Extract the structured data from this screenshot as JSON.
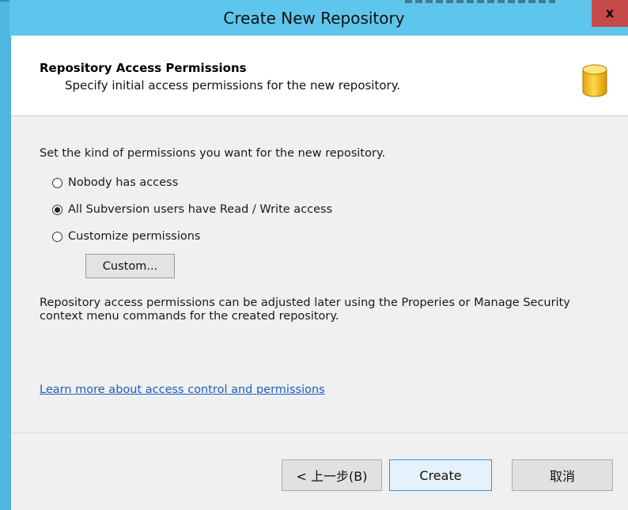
{
  "window": {
    "title": "Create New Repository",
    "close_glyph": "x"
  },
  "header": {
    "title": "Repository Access Permissions",
    "subtitle": "Specify initial access permissions for the new repository.",
    "icon": "database-icon"
  },
  "permissions": {
    "intro": "Set the kind of permissions you want for the new repository.",
    "options": [
      {
        "label": "Nobody has access",
        "selected": false
      },
      {
        "label": "All Subversion users have Read / Write access",
        "selected": true
      },
      {
        "label": "Customize permissions",
        "selected": false
      }
    ],
    "custom_button": "Custom...",
    "info": "Repository access permissions can be adjusted later using the Properies or Manage Security context menu commands for the created repository.",
    "learn_more_link": "Learn more about access control and permissions"
  },
  "footer": {
    "back_button": "< 上一步(B)",
    "create_button": "Create",
    "cancel_button": "取消"
  },
  "colors": {
    "titlebar": "#5ec6ec",
    "close_button": "#c74a4a",
    "link": "#1c5fbf",
    "primary_button_border": "#3c8fd6"
  }
}
